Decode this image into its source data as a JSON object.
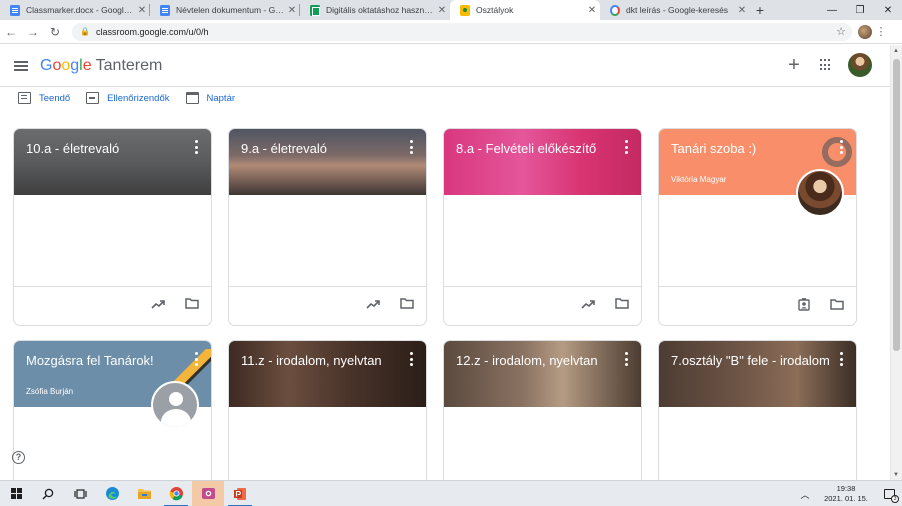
{
  "browser": {
    "tabs": [
      {
        "title": "Classmarker.docx - Google Do",
        "favicon": "docs-icon"
      },
      {
        "title": "Névtelen dokumentum - Goog",
        "favicon": "docs-icon"
      },
      {
        "title": "Digitális oktatáshoz hasznos p",
        "favicon": "sheets-icon"
      },
      {
        "title": "Osztályok",
        "favicon": "classroom-icon",
        "active": true
      },
      {
        "title": "dkt leírás - Google-keresés",
        "favicon": "google-icon"
      }
    ],
    "url": "classroom.google.com/u/0/h"
  },
  "header": {
    "logo_google": [
      "G",
      "o",
      "o",
      "g",
      "l",
      "e"
    ],
    "product": "Tanterem"
  },
  "subnav": {
    "todo": "Teendő",
    "review": "Ellenőrizendők",
    "calendar": "Naptár"
  },
  "cards": [
    {
      "title": "10.a - életrevaló",
      "owner": ""
    },
    {
      "title": "9.a - életrevaló",
      "owner": ""
    },
    {
      "title": "8.a - Felvételi előkészítő",
      "owner": ""
    },
    {
      "title": "Tanári szoba :)",
      "owner": "Viktória Magyar"
    },
    {
      "title": "Mozgásra fel Tanárok!",
      "owner": "Zsófia Burján"
    },
    {
      "title": "11.z - irodalom, nyelvtan",
      "owner": ""
    },
    {
      "title": "12.z - irodalom, nyelvtan",
      "owner": ""
    },
    {
      "title": "7.osztály \"B\" fele - irodalom",
      "owner": ""
    }
  ],
  "taskbar": {
    "time": "19:38",
    "date": "2021. 01. 15.",
    "notifications": "3"
  },
  "colors": {
    "accent_blue": "#1967d2",
    "card_orange": "#f88f6a",
    "card_pink": "#d9377e",
    "card_steel": "#6d8ea8"
  }
}
